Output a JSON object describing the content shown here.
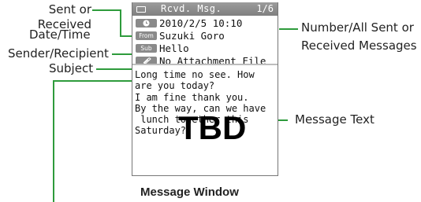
{
  "callouts": {
    "date_line1": "Sent or Received",
    "date_line2": "Date/Time",
    "sender": "Sender/Recipient",
    "subject": "Subject",
    "number_line1": "Number/All Sent or",
    "number_line2": "Received Messages",
    "message_text": "Message Text"
  },
  "screen": {
    "title": "Rcvd. Msg.",
    "count": "1/6",
    "rows": [
      {
        "icon": "clock-icon",
        "icon_label": "",
        "value": "2010/2/5 10:10"
      },
      {
        "icon": "from-icon",
        "icon_label": "From",
        "value": "Suzuki Goro"
      },
      {
        "icon": "sub-icon",
        "icon_label": "Sub",
        "value": "Hello"
      },
      {
        "icon": "paperclip-icon",
        "icon_label": "",
        "value": "No Attachment File"
      }
    ],
    "message_lines": [
      "Long time no see. How",
      "are you today?",
      "I am fine thank you.",
      "By the way, can we have",
      " lunch together this",
      "Saturday?"
    ],
    "overlay_label": "TBD"
  },
  "caption": "Message Window",
  "colors": {
    "leader": "#2e9b3c",
    "titlebar": "#8c8c8c"
  }
}
